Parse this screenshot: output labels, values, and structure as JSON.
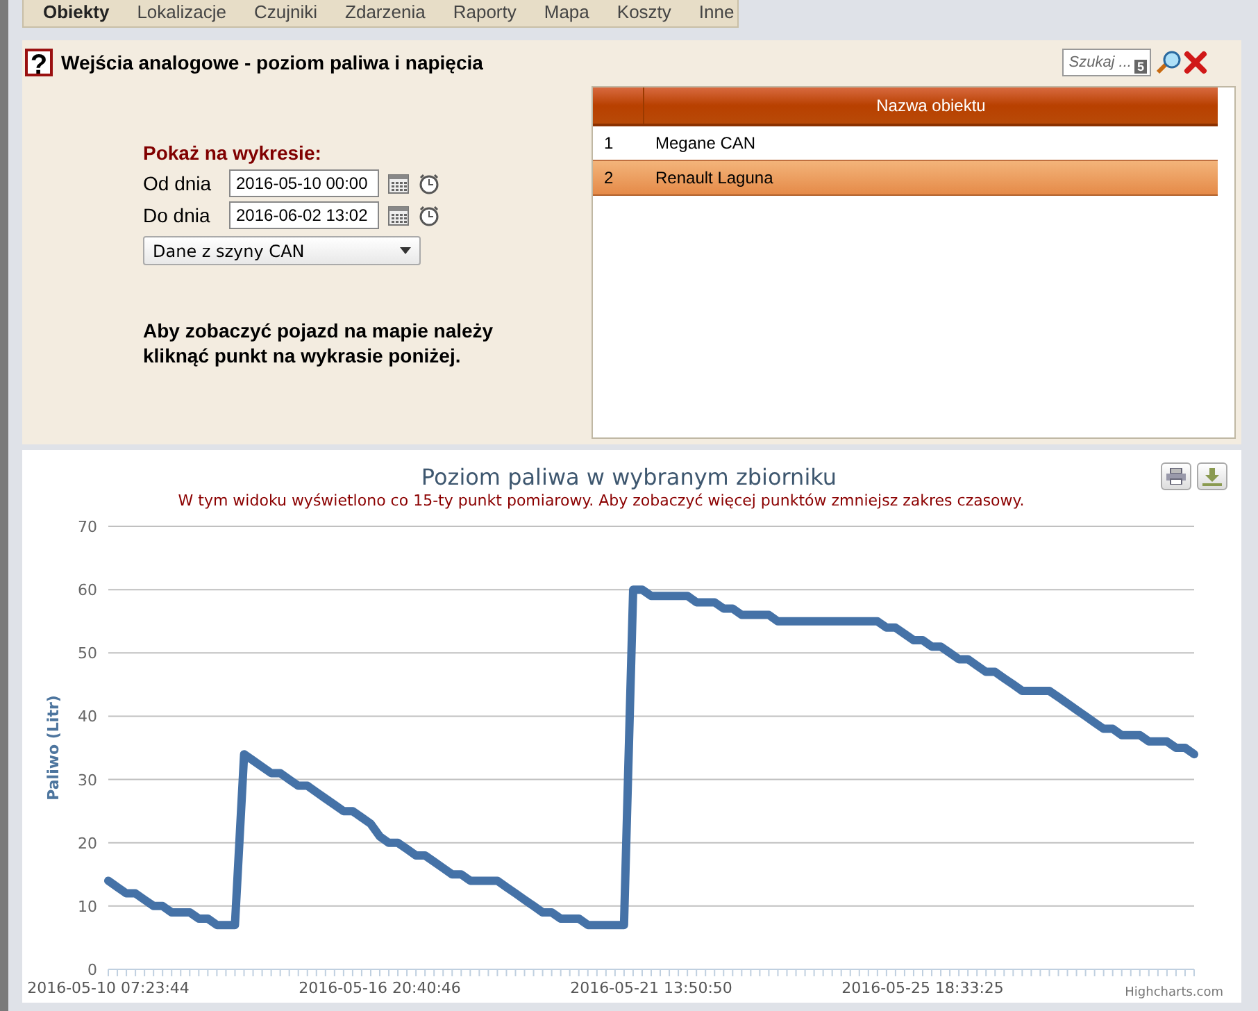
{
  "tabs": [
    {
      "label": "Obiekty",
      "selected": true
    },
    {
      "label": "Lokalizacje",
      "selected": false
    },
    {
      "label": "Czujniki",
      "selected": false
    },
    {
      "label": "Zdarzenia",
      "selected": false
    },
    {
      "label": "Raporty",
      "selected": false
    },
    {
      "label": "Mapa",
      "selected": false
    },
    {
      "label": "Koszty",
      "selected": false
    },
    {
      "label": "Inne",
      "selected": false
    }
  ],
  "header": {
    "help": "?",
    "title": "Wejścia analogowe - poziom paliwa i napięcia",
    "search_placeholder": "Szukaj ...",
    "search_badge": "5"
  },
  "form": {
    "heading": "Pokaż na wykresie:",
    "from_label": "Od dnia",
    "from_value": "2016-05-10 00:00",
    "to_label": "Do dnia",
    "to_value": "2016-06-02 13:02",
    "source": "Dane z szyny CAN",
    "hint": "Aby zobaczyć pojazd na mapie należy kliknąć punkt na wykrasie poniżej."
  },
  "table": {
    "columns": [
      "Nazwa obiektu"
    ],
    "rows": [
      {
        "number": "1",
        "name": "Megane CAN",
        "selected": false
      },
      {
        "number": "2",
        "name": "Renault Laguna",
        "selected": true
      }
    ]
  },
  "chart": {
    "subtitle": "W tym widoku wyświetlono co 15-ty punkt pomiarowy. Aby zobaczyć więcej punktów zmniejsz zakres czasowy.",
    "credits": "Highcharts.com",
    "chart_data": {
      "type": "line",
      "title": "Poziom paliwa w wybranym zbiorniku",
      "ylabel": "Paliwo (Litr)",
      "ylim": [
        0,
        70
      ],
      "yticks": [
        0,
        10,
        20,
        30,
        40,
        50,
        60,
        70
      ],
      "grid": true,
      "categories": [
        "2016-05-10 07:23:44",
        null,
        null,
        null,
        null,
        null,
        null,
        null,
        null,
        null,
        null,
        null,
        null,
        null,
        null,
        null,
        null,
        null,
        null,
        null,
        null,
        null,
        null,
        null,
        null,
        null,
        null,
        null,
        null,
        null,
        "2016-05-16 20:40:46",
        null,
        null,
        null,
        null,
        null,
        null,
        null,
        null,
        null,
        null,
        null,
        null,
        null,
        null,
        null,
        null,
        null,
        null,
        null,
        null,
        null,
        null,
        null,
        null,
        null,
        null,
        null,
        null,
        null,
        "2016-05-21 13:50:50",
        null,
        null,
        null,
        null,
        null,
        null,
        null,
        null,
        null,
        null,
        null,
        null,
        null,
        null,
        null,
        null,
        null,
        null,
        null,
        null,
        null,
        null,
        null,
        null,
        null,
        null,
        null,
        null,
        null,
        "2016-05-25 18:33:25",
        null,
        null,
        null,
        null,
        null,
        null,
        null,
        null,
        null,
        null,
        null,
        null,
        null,
        null,
        null,
        null,
        null,
        null,
        null,
        null,
        null,
        null,
        null,
        null,
        null,
        null,
        null,
        null,
        null,
        null
      ],
      "series": [
        {
          "color": "#4572a7",
          "values": [
            14,
            13,
            12,
            12,
            11,
            10,
            10,
            9,
            9,
            9,
            8,
            8,
            7,
            7,
            7,
            34,
            33,
            32,
            31,
            31,
            30,
            29,
            29,
            28,
            27,
            26,
            25,
            25,
            24,
            23,
            21,
            20,
            20,
            19,
            18,
            18,
            17,
            16,
            15,
            15,
            14,
            14,
            14,
            14,
            13,
            12,
            11,
            10,
            9,
            9,
            8,
            8,
            8,
            7,
            7,
            7,
            7,
            7,
            60,
            60,
            59,
            59,
            59,
            59,
            59,
            58,
            58,
            58,
            57,
            57,
            56,
            56,
            56,
            56,
            55,
            55,
            55,
            55,
            55,
            55,
            55,
            55,
            55,
            55,
            55,
            55,
            54,
            54,
            53,
            52,
            52,
            51,
            51,
            50,
            49,
            49,
            48,
            47,
            47,
            46,
            45,
            44,
            44,
            44,
            44,
            43,
            42,
            41,
            40,
            39,
            38,
            38,
            37,
            37,
            37,
            36,
            36,
            36,
            35,
            35,
            34
          ]
        }
      ]
    }
  }
}
